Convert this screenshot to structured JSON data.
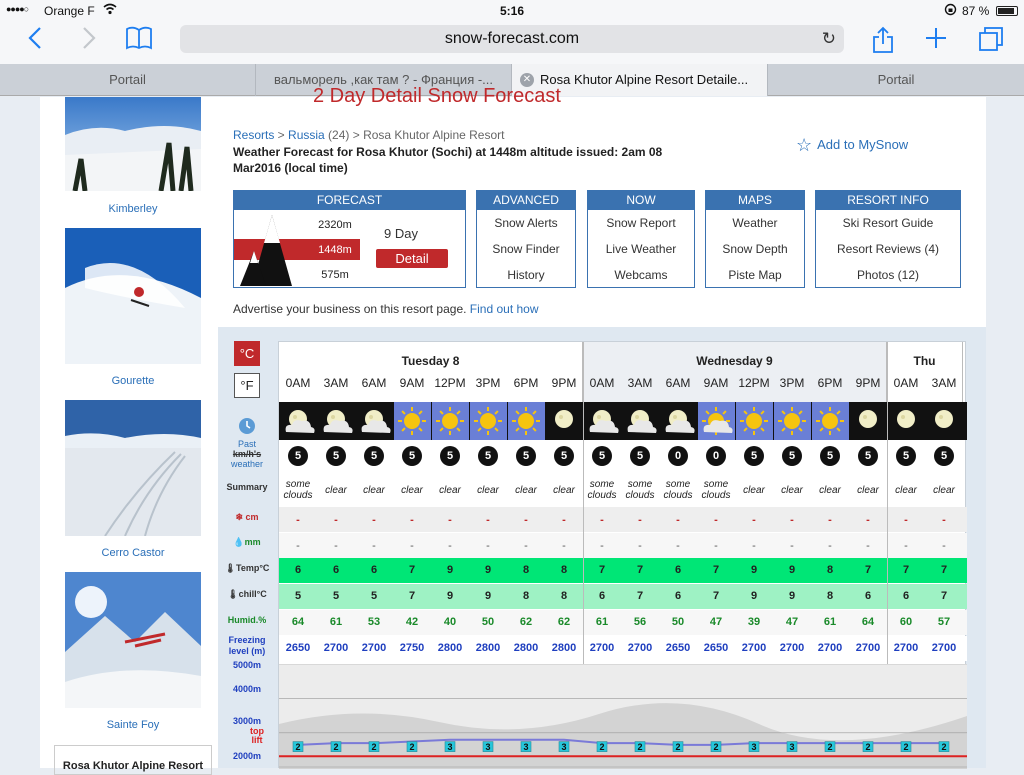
{
  "status": {
    "carrier": "Orange F",
    "time": "5:16",
    "battery": "87 %"
  },
  "browser": {
    "url": "snow-forecast.com"
  },
  "tabs": [
    {
      "label": "Portail"
    },
    {
      "label": "вальморель ,как там ? - Франция -..."
    },
    {
      "label": "Rosa Khutor Alpine Resort Detaile..."
    },
    {
      "label": "Portail"
    }
  ],
  "sidebar": {
    "items": [
      {
        "label": "Kimberley"
      },
      {
        "label": "Gourette"
      },
      {
        "label": "Cerro Castor"
      },
      {
        "label": "Sainte Foy"
      }
    ],
    "box_title": "Rosa Khutor Alpine Resort"
  },
  "header": {
    "title": "2 Day Detail Snow Forecast",
    "breadcrumb": {
      "resorts": "Resorts",
      "sep1": " > ",
      "russia": "Russia",
      "count": " (24) > ",
      "current": "Rosa Khutor Alpine Resort"
    },
    "weather_title": "Weather Forecast for Rosa Khutor (Sochi) at 1448m altitude issued: 2am 08 Mar2016 (local time)",
    "add_mysnow": "Add to MySnow"
  },
  "menus": {
    "forecast": {
      "title": "FORECAST",
      "alt_top": "2320m",
      "alt_mid": "1448m",
      "alt_bot": "575m",
      "nine_day": "9 Day",
      "detail": "Detail"
    },
    "advanced": {
      "title": "ADVANCED",
      "items": [
        "Snow Alerts",
        "Snow Finder",
        "History"
      ]
    },
    "now": {
      "title": "NOW",
      "items": [
        "Snow Report",
        "Live Weather",
        "Webcams"
      ]
    },
    "maps": {
      "title": "MAPS",
      "items": [
        "Weather",
        "Snow Depth",
        "Piste Map"
      ]
    },
    "resort": {
      "title": "RESORT INFO",
      "items": [
        "Ski Resort Guide",
        "Resort Reviews (4)",
        "Photos (12)"
      ]
    }
  },
  "advertise": {
    "text": "Advertise your business on this resort page. ",
    "link": "Find out how"
  },
  "forecast_table": {
    "unit_c": "°C",
    "unit_f": "°F",
    "row_labels": {
      "past1": "Past",
      "past2": "km/h's",
      "past3": "weather",
      "summary": "Summary",
      "snow": "cm",
      "rain": "mm",
      "temp": "Temp°C",
      "chill": "chill°C",
      "humid": "Humid.%",
      "freezing1": "Freezing",
      "freezing2": "level (m)",
      "alt5000": "5000m",
      "alt4000": "4000m",
      "alt3000": "3000m",
      "alt2000": "2000m",
      "toplift1": "top",
      "toplift2": "lift"
    },
    "days": [
      {
        "label": "Tuesday 8",
        "span": 8
      },
      {
        "label": "Wednesday 9",
        "span": 8
      },
      {
        "label": "Thu",
        "span": 2
      }
    ],
    "hours": [
      "0AM",
      "3AM",
      "6AM",
      "9AM",
      "12PM",
      "3PM",
      "6PM",
      "9PM",
      "0AM",
      "3AM",
      "6AM",
      "9AM",
      "12PM",
      "3PM",
      "6PM",
      "9PM",
      "0AM",
      "3AM"
    ],
    "icons": [
      "moon-cloud",
      "moon-cloud",
      "moon-cloud",
      "sun",
      "sun",
      "sun",
      "sun",
      "moon",
      "moon-cloud",
      "moon-cloud",
      "moon-cloud",
      "sun-cloud",
      "sun",
      "sun",
      "sun",
      "moon",
      "moon",
      "moon"
    ],
    "wind": [
      "5",
      "5",
      "5",
      "5",
      "5",
      "5",
      "5",
      "5",
      "5",
      "5",
      "0",
      "0",
      "5",
      "5",
      "5",
      "5",
      "5",
      "5"
    ],
    "summary": [
      "some clouds",
      "clear",
      "clear",
      "clear",
      "clear",
      "clear",
      "clear",
      "clear",
      "some clouds",
      "some clouds",
      "some clouds",
      "some clouds",
      "clear",
      "clear",
      "clear",
      "clear",
      "clear",
      "clear"
    ],
    "snow": [
      "-",
      "-",
      "-",
      "-",
      "-",
      "-",
      "-",
      "-",
      "-",
      "-",
      "-",
      "-",
      "-",
      "-",
      "-",
      "-",
      "-",
      "-"
    ],
    "rain": [
      "-",
      "-",
      "-",
      "-",
      "-",
      "-",
      "-",
      "-",
      "-",
      "-",
      "-",
      "-",
      "-",
      "-",
      "-",
      "-",
      "-",
      "-"
    ],
    "temp": [
      "6",
      "6",
      "6",
      "7",
      "9",
      "9",
      "8",
      "8",
      "7",
      "7",
      "6",
      "7",
      "9",
      "9",
      "8",
      "7",
      "7",
      "7"
    ],
    "chill": [
      "5",
      "5",
      "5",
      "7",
      "9",
      "9",
      "8",
      "8",
      "6",
      "7",
      "6",
      "7",
      "9",
      "9",
      "8",
      "6",
      "6",
      "7"
    ],
    "humid": [
      "64",
      "61",
      "53",
      "42",
      "40",
      "50",
      "62",
      "62",
      "61",
      "56",
      "50",
      "47",
      "39",
      "47",
      "61",
      "64",
      "60",
      "57"
    ],
    "freezing": [
      "2650",
      "2700",
      "2700",
      "2750",
      "2800",
      "2800",
      "2800",
      "2800",
      "2700",
      "2700",
      "2650",
      "2650",
      "2700",
      "2700",
      "2700",
      "2700",
      "2700",
      "2700"
    ],
    "chart_markers": [
      "2",
      "2",
      "2",
      "2",
      "3",
      "3",
      "3",
      "3",
      "2",
      "2",
      "2",
      "2",
      "3",
      "3",
      "2",
      "2",
      "2",
      "2"
    ],
    "colors": {
      "temp_band": "#00e676",
      "chill_band": "#9ef2c4",
      "alt_red": "#d22",
      "marker": "#26c6da"
    }
  }
}
